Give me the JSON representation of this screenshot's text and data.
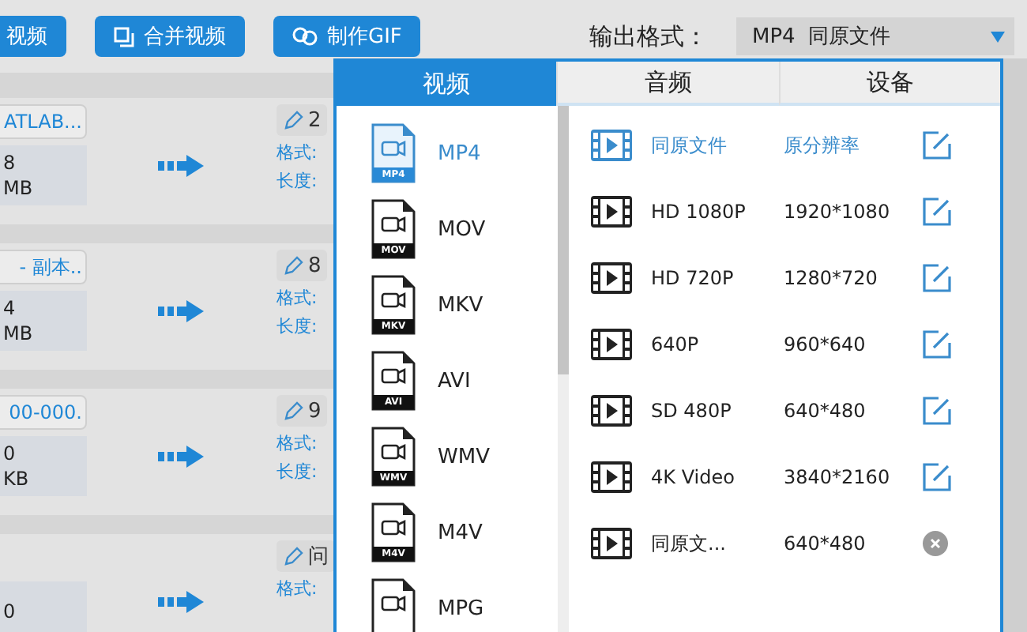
{
  "toolbar": {
    "buttons": [
      {
        "kind": "plain",
        "label": "视频"
      },
      {
        "kind": "merge",
        "label": "合并视频"
      },
      {
        "kind": "gif",
        "label": "制作GIF"
      }
    ],
    "output_format": {
      "label": "输出格式：",
      "value": "MP4  同原文件"
    }
  },
  "files": [
    {
      "name": "ATLAB...",
      "line_1": "8",
      "line_2": "MB",
      "target": "2",
      "format_label": "格式:",
      "length_label": "长度:"
    },
    {
      "name": "- 副本..",
      "line_1": "4",
      "line_2": "MB",
      "target": "8",
      "format_label": "格式:",
      "length_label": "长度:"
    },
    {
      "name": "00-000.",
      "line_1": "0",
      "line_2": "KB",
      "target": "9",
      "format_label": "格式:",
      "length_label": "长度:"
    },
    {
      "line_1": "0",
      "target": "问",
      "format_label": "格式:"
    }
  ],
  "popup": {
    "tabs": [
      {
        "label": "视频",
        "selected": true
      },
      {
        "label": "音频",
        "selected": false
      },
      {
        "label": "设备",
        "selected": false
      }
    ],
    "formats": [
      {
        "name": "MP4",
        "badge": "MP4",
        "selected": true
      },
      {
        "name": "MOV",
        "badge": "MOV",
        "selected": false
      },
      {
        "name": "MKV",
        "badge": "MKV",
        "selected": false
      },
      {
        "name": "AVI",
        "badge": "AVI",
        "selected": false
      },
      {
        "name": "WMV",
        "badge": "WMV",
        "selected": false
      },
      {
        "name": "M4V",
        "badge": "M4V",
        "selected": false
      },
      {
        "name": "MPG",
        "selected": false
      }
    ],
    "presets": [
      {
        "name": "同原文件",
        "resolution": "原分辨率",
        "kind": "edit",
        "selected": true
      },
      {
        "name": "HD 1080P",
        "resolution": "1920*1080",
        "kind": "edit",
        "selected": false
      },
      {
        "name": "HD 720P",
        "resolution": "1280*720",
        "kind": "edit",
        "selected": false
      },
      {
        "name": "640P",
        "resolution": "960*640",
        "kind": "edit",
        "selected": false
      },
      {
        "name": "SD 480P",
        "resolution": "640*480",
        "kind": "edit",
        "selected": false
      },
      {
        "name": "4K Video",
        "resolution": "3840*2160",
        "kind": "edit",
        "selected": false
      },
      {
        "name": "同原文...",
        "resolution": "640*480",
        "kind": "delete",
        "selected": false
      }
    ]
  }
}
